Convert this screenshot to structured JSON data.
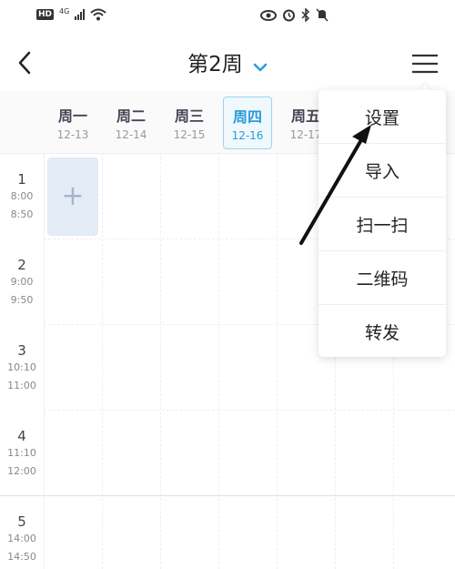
{
  "status_bar": {
    "hd": "HD",
    "network": "4G"
  },
  "header": {
    "title": "第2周"
  },
  "week": {
    "days": [
      {
        "name": "周一",
        "date": "12-13"
      },
      {
        "name": "周二",
        "date": "12-14"
      },
      {
        "name": "周三",
        "date": "12-15"
      },
      {
        "name": "周四",
        "date": "12-16"
      },
      {
        "name": "周五",
        "date": "12-17"
      }
    ],
    "today_index": 3
  },
  "periods": [
    {
      "num": "1",
      "start": "8:00",
      "end": "8:50"
    },
    {
      "num": "2",
      "start": "9:00",
      "end": "9:50"
    },
    {
      "num": "3",
      "start": "10:10",
      "end": "11:00"
    },
    {
      "num": "4",
      "start": "11:10",
      "end": "12:00"
    },
    {
      "num": "5",
      "start": "14:00",
      "end": "14:50"
    }
  ],
  "add_cell": {
    "label": "+"
  },
  "menu": {
    "items": [
      {
        "label": "设置"
      },
      {
        "label": "导入"
      },
      {
        "label": "扫一扫"
      },
      {
        "label": "二维码"
      },
      {
        "label": "转发"
      }
    ]
  },
  "colors": {
    "accent": "#2a9bd6",
    "add_cell_bg": "#e4ecf5"
  }
}
